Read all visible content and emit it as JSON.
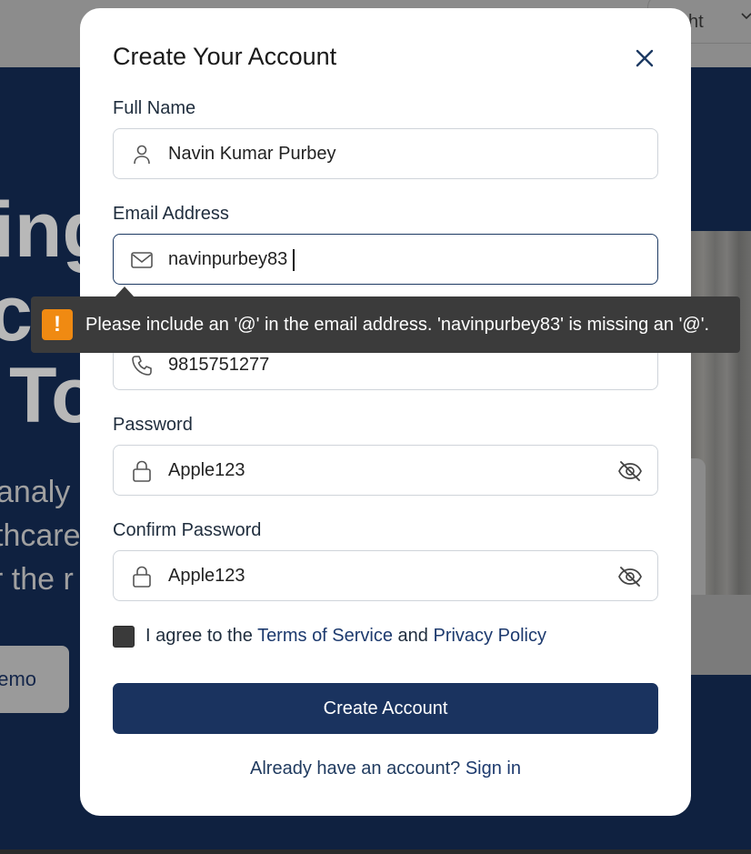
{
  "background": {
    "language_selector": "ht",
    "hero_lines": [
      "ing",
      "ca",
      "To"
    ],
    "hero_paragraph": [
      " analy",
      "thcare",
      "r the r"
    ],
    "demo_button": "emo"
  },
  "modal": {
    "title": "Create Your Account",
    "full_name": {
      "label": "Full Name",
      "value": "Navin Kumar Purbey"
    },
    "email": {
      "label": "Email Address",
      "value": "navinpurbey83"
    },
    "phone": {
      "value": "9815751277"
    },
    "password": {
      "label": "Password",
      "value": "Apple123"
    },
    "confirm_password": {
      "label": "Confirm Password",
      "value": "Apple123"
    },
    "agree": {
      "prefix": "I agree to the ",
      "terms": "Terms of Service",
      "middle": " and ",
      "privacy": "Privacy Policy"
    },
    "submit_label": "Create Account",
    "signin_prompt": "Already have an account? ",
    "signin_link": "Sign in"
  },
  "tooltip": {
    "message": "Please include an '@' in the email address. 'navinpurbey83' is missing an '@'."
  },
  "colors": {
    "primary": "#1a335f",
    "link": "#1d3a6e",
    "warning": "#f08a12",
    "tooltip_bg": "#3b3b3b"
  }
}
